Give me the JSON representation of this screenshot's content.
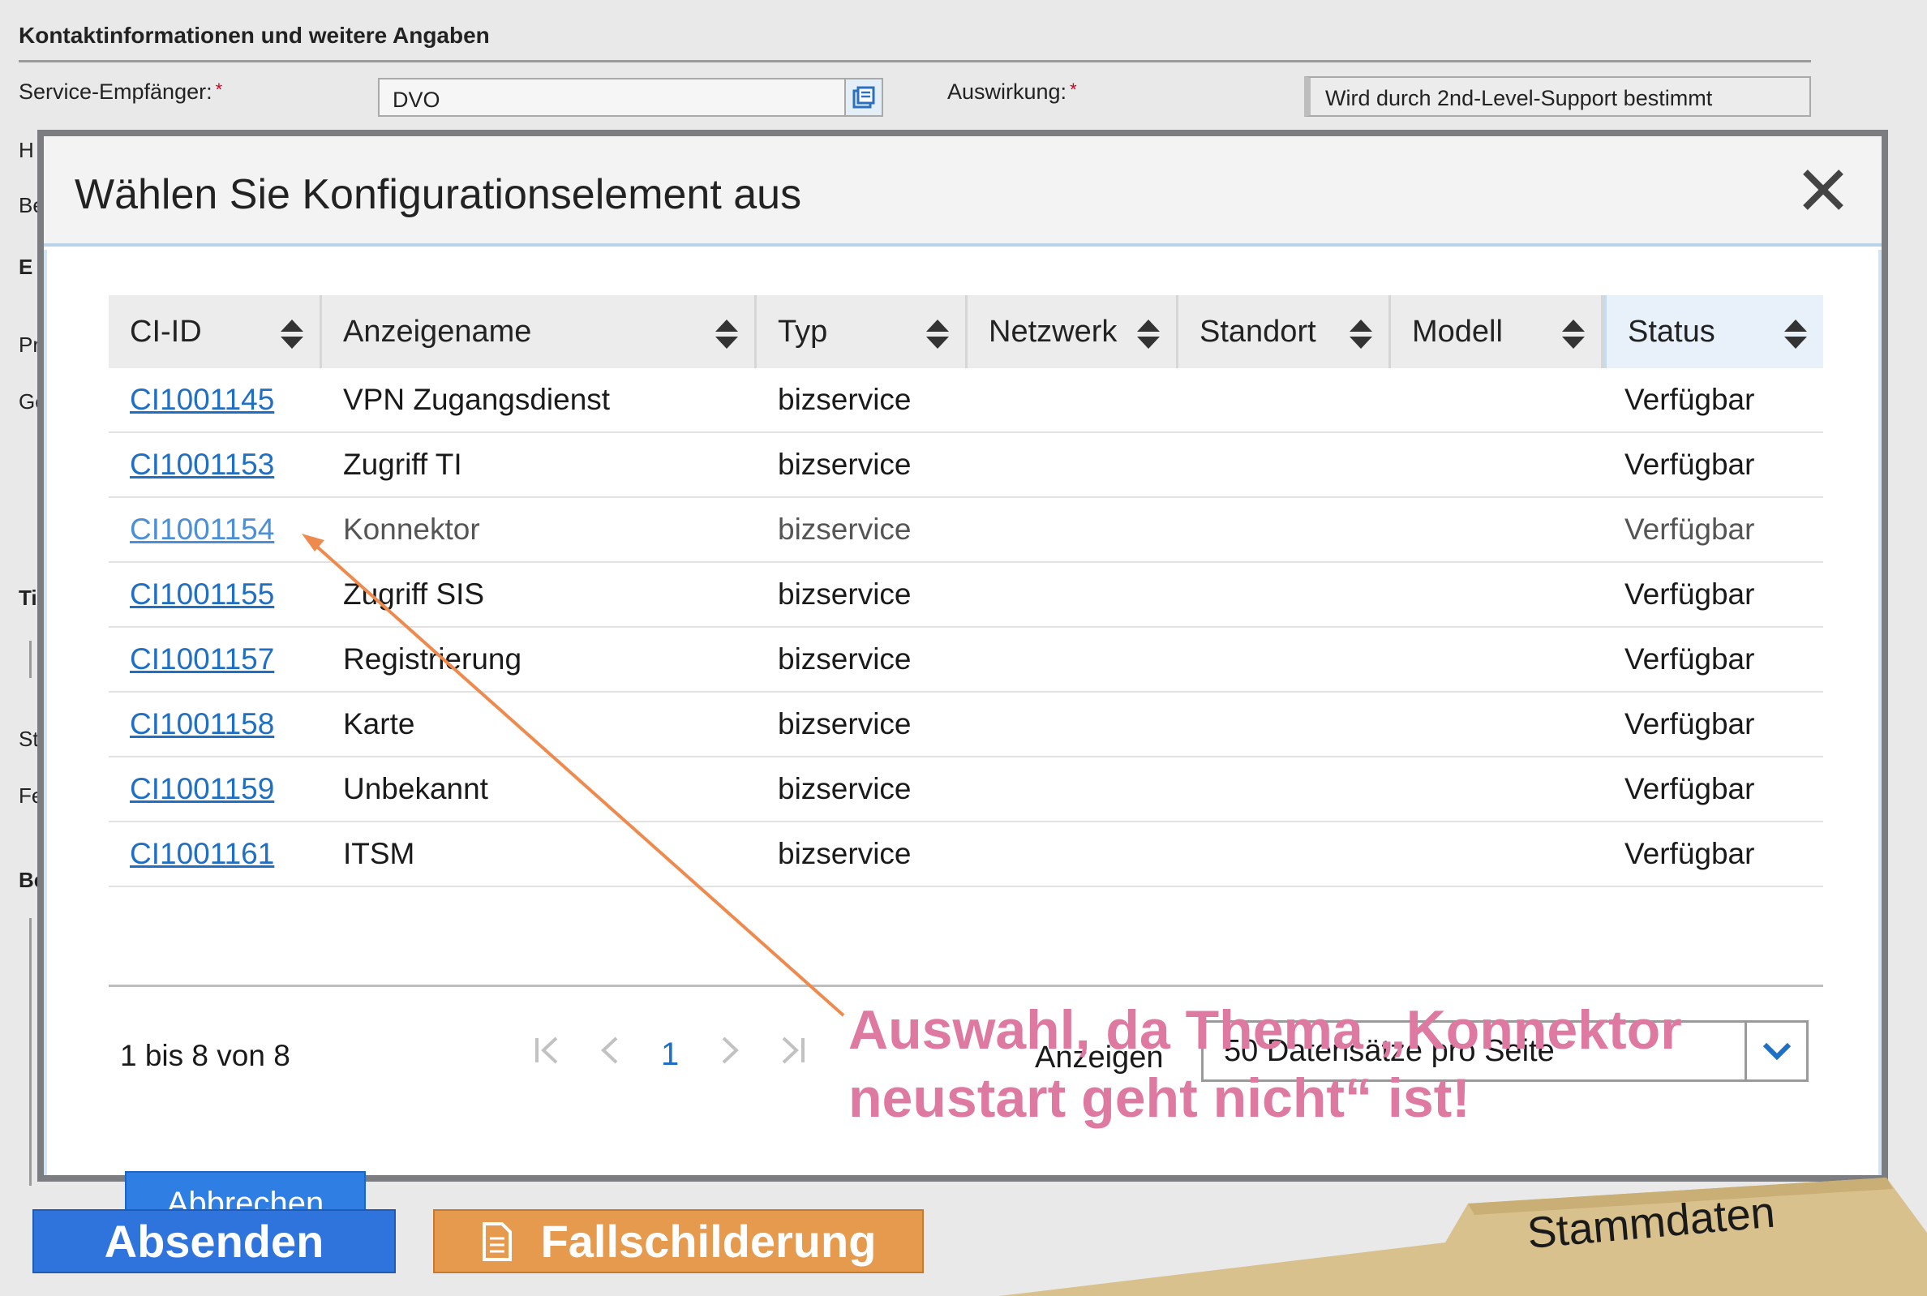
{
  "form": {
    "heading": "Kontaktinformationen und weitere Angaben",
    "service_recipient_label": "Service-Empfänger:",
    "required_marker": "*",
    "service_recipient_value": "DVO",
    "impact_label": "Auswirkung:",
    "impact_value": "Wird durch 2nd-Level-Support bestimmt",
    "truncated_labels": [
      "H",
      "Be",
      "E",
      "Pr",
      "Ge",
      "Ti",
      "St",
      "Fe",
      "Be"
    ]
  },
  "dialog": {
    "title": "Wählen Sie Konfigurationselement aus",
    "close_icon": "close-icon",
    "columns": [
      "CI-ID",
      "Anzeigename",
      "Typ",
      "Netzwerk",
      "Standort",
      "Modell",
      "Status"
    ],
    "rows": [
      {
        "id": "CI1001145",
        "name": "VPN Zugangsdienst",
        "type": "bizservice",
        "network": "",
        "location": "",
        "model": "",
        "status": "Verfügbar"
      },
      {
        "id": "CI1001153",
        "name": "Zugriff TI",
        "type": "bizservice",
        "network": "",
        "location": "",
        "model": "",
        "status": "Verfügbar"
      },
      {
        "id": "CI1001154",
        "name": "Konnektor",
        "type": "bizservice",
        "network": "",
        "location": "",
        "model": "",
        "status": "Verfügbar"
      },
      {
        "id": "CI1001155",
        "name": "Zugriff SIS",
        "type": "bizservice",
        "network": "",
        "location": "",
        "model": "",
        "status": "Verfügbar"
      },
      {
        "id": "CI1001157",
        "name": "Registrierung",
        "type": "bizservice",
        "network": "",
        "location": "",
        "model": "",
        "status": "Verfügbar"
      },
      {
        "id": "CI1001158",
        "name": "Karte",
        "type": "bizservice",
        "network": "",
        "location": "",
        "model": "",
        "status": "Verfügbar"
      },
      {
        "id": "CI1001159",
        "name": "Unbekannt",
        "type": "bizservice",
        "network": "",
        "location": "",
        "model": "",
        "status": "Verfügbar"
      },
      {
        "id": "CI1001161",
        "name": "ITSM",
        "type": "bizservice",
        "network": "",
        "location": "",
        "model": "",
        "status": "Verfügbar"
      }
    ],
    "highlighted_row": 2,
    "pagination": {
      "range_text": "1 bis 8 von 8",
      "current_page": "1",
      "show_label": "Anzeigen",
      "page_size_value": "50 Datensätze pro Seite"
    },
    "cancel_label": "Abbrechen"
  },
  "annotation": {
    "line1": "Auswahl, da Thema „Konnektor",
    "line2": "neustart geht nicht“ ist!",
    "color": "#de7aa1",
    "arrow_color": "#ef8a4f"
  },
  "footer": {
    "send_label": "Absenden",
    "case_label": "Fallschilderung",
    "tab_label": "Stammdaten"
  },
  "colors": {
    "primary_blue": "#2f74dc",
    "orange": "#e69a4e",
    "link": "#1f6fc5",
    "tab": "#d9c18e"
  }
}
